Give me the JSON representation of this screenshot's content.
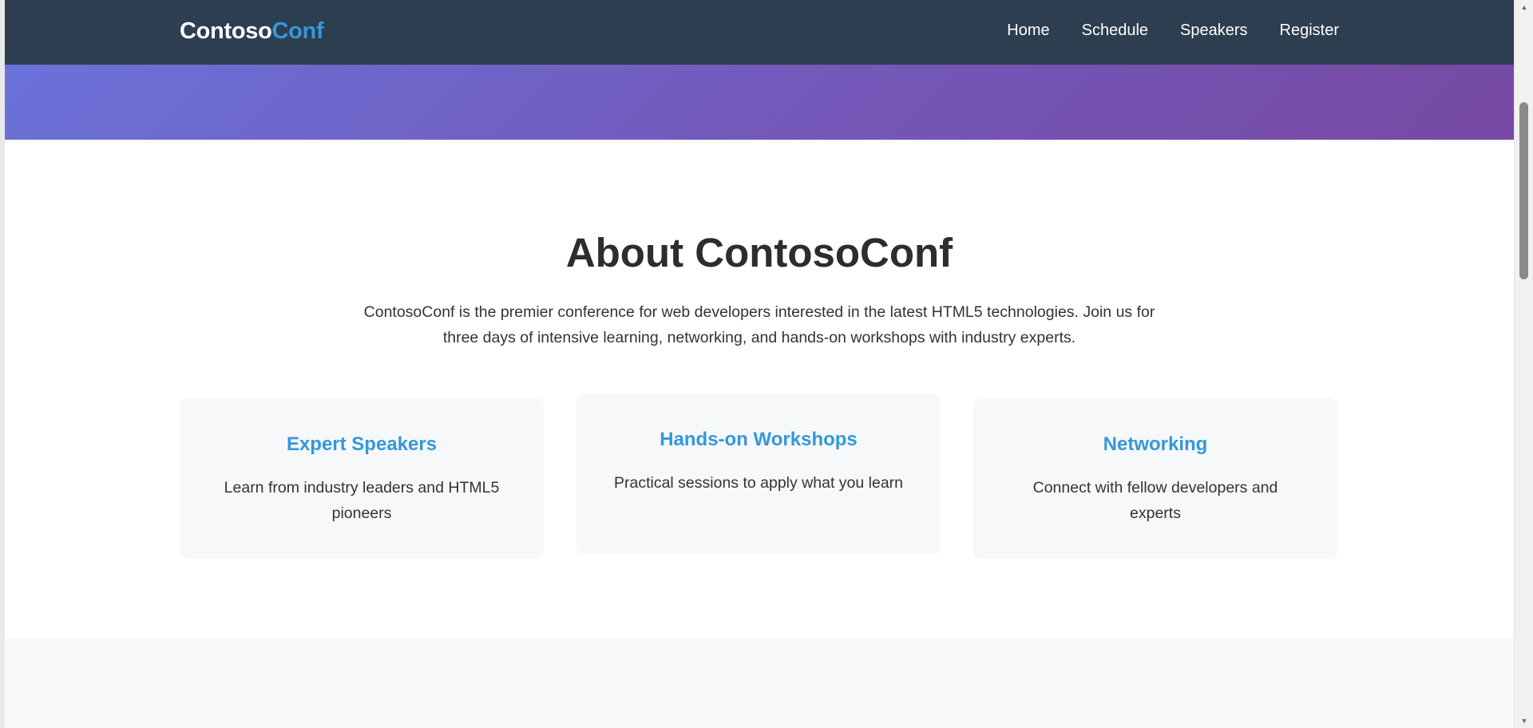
{
  "header": {
    "logo_primary": "Contoso",
    "logo_accent": "Conf",
    "nav": [
      {
        "label": "Home"
      },
      {
        "label": "Schedule"
      },
      {
        "label": "Speakers"
      },
      {
        "label": "Register"
      }
    ]
  },
  "colors": {
    "header_bg": "#2c3e50",
    "accent": "#3498db",
    "hero_gradient_start": "#6a72d9",
    "hero_gradient_end": "#7649a3",
    "card_bg": "#f7f8fa"
  },
  "about": {
    "title": "About ContosoConf",
    "description": "ContosoConf is the premier conference for web developers interested in the latest HTML5 technologies. Join us for three days of intensive learning, networking, and hands-on workshops with industry experts.",
    "features": [
      {
        "title": "Expert Speakers",
        "text": "Learn from industry leaders and HTML5 pioneers"
      },
      {
        "title": "Hands-on Workshops",
        "text": "Practical sessions to apply what you learn"
      },
      {
        "title": "Networking",
        "text": "Connect with fellow developers and experts"
      }
    ]
  },
  "scrollbar": {
    "up_icon": "triangle-up",
    "down_icon": "triangle-down"
  }
}
